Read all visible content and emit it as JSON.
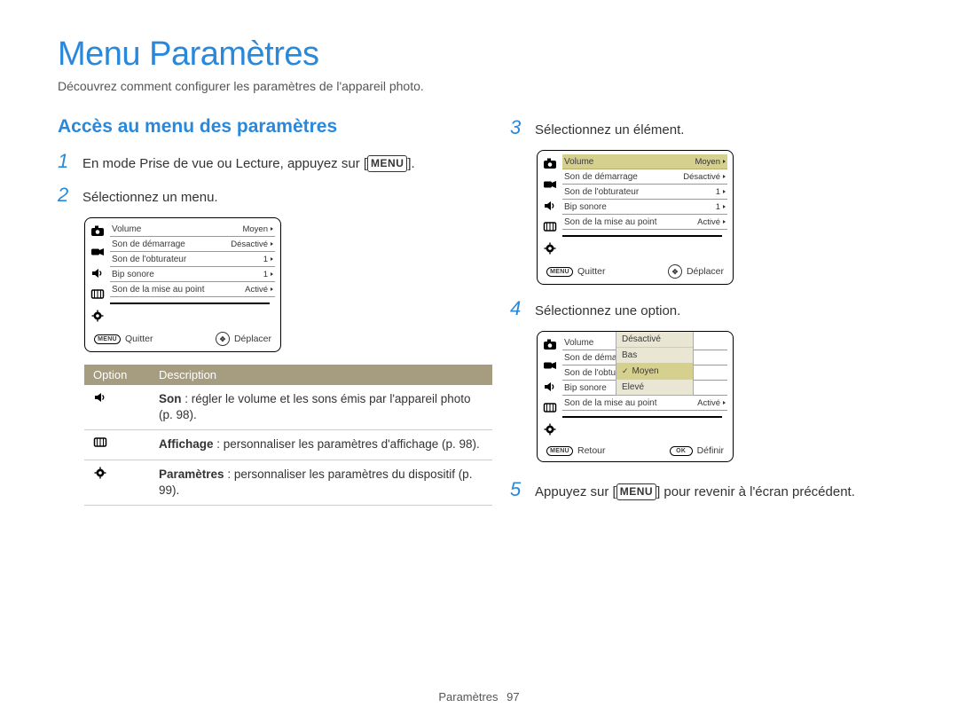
{
  "title": "Menu Paramètres",
  "subtitle": "Découvrez comment configurer les paramètres de l'appareil photo.",
  "section_heading": "Accès au menu des paramètres",
  "steps": {
    "s1_pre": "En mode Prise de vue ou Lecture, appuyez sur [",
    "s1_btn": "MENU",
    "s1_post": "].",
    "s2": "Sélectionnez un menu.",
    "s3": "Sélectionnez un élément.",
    "s4": "Sélectionnez une option.",
    "s5_pre": "Appuyez sur [",
    "s5_btn": "MENU",
    "s5_post": "] pour revenir à l'écran précédent."
  },
  "nums": {
    "n1": "1",
    "n2": "2",
    "n3": "3",
    "n4": "4",
    "n5": "5"
  },
  "screen_rows": {
    "r0": {
      "label": "Volume",
      "value": "Moyen"
    },
    "r1": {
      "label": "Son de démarrage",
      "value": "Désactivé"
    },
    "r2": {
      "label": "Son de l'obturateur",
      "value": "1"
    },
    "r3": {
      "label": "Bip sonore",
      "value": "1"
    },
    "r4": {
      "label": "Son de la mise au point",
      "value": "Activé"
    }
  },
  "screen_foot": {
    "menu_btn": "MENU",
    "quit": "Quitter",
    "move": "Déplacer",
    "back": "Retour",
    "ok_btn": "OK",
    "set": "Définir"
  },
  "dropdown": {
    "o0": "Désactivé",
    "o1": "Bas",
    "o2": "Moyen",
    "o3": "Elevé"
  },
  "table": {
    "head_option": "Option",
    "head_desc": "Description",
    "row0": {
      "bold": "Son",
      "rest": " : régler le volume et les sons émis par l'appareil photo (p. 98)."
    },
    "row1": {
      "bold": "Affichage",
      "rest": " : personnaliser les paramètres d'affichage (p. 98)."
    },
    "row2": {
      "bold": "Paramètres",
      "rest": " : personnaliser les paramètres du dispositif (p. 99)."
    }
  },
  "footer": {
    "label": "Paramètres",
    "page": "97"
  },
  "dd_cut_labels": {
    "r1": "Son de déma",
    "r2": "Son de l'obtu"
  }
}
